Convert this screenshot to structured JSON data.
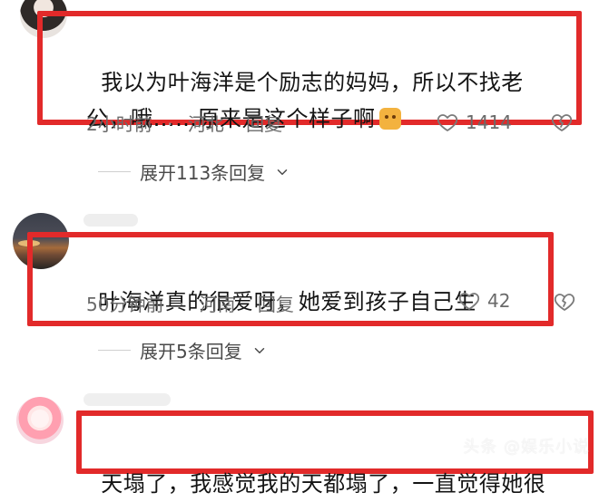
{
  "comments": [
    {
      "text": "我以为叶海洋是个励志的妈妈，所以不找老公，哦……原来是这个样子啊",
      "emoji": "cat-face-emoji",
      "time": "2小时前",
      "location": "河北",
      "reply_label": "回复",
      "likes": "1414",
      "expand_label": "展开113条回复"
    },
    {
      "text": "叶海洋真的很爱呀，她爱到孩子自己生",
      "time": "50分钟前",
      "location": "河南",
      "reply_label": "回复",
      "likes": "42",
      "expand_label": "展开5条回复"
    },
    {
      "text": "天塌了，我感觉我的天都塌了，一直觉得她很"
    }
  ],
  "watermark": "头条 @娱乐小说",
  "colors": {
    "highlight": "#e22a2a",
    "meta": "#6a6a6a"
  }
}
